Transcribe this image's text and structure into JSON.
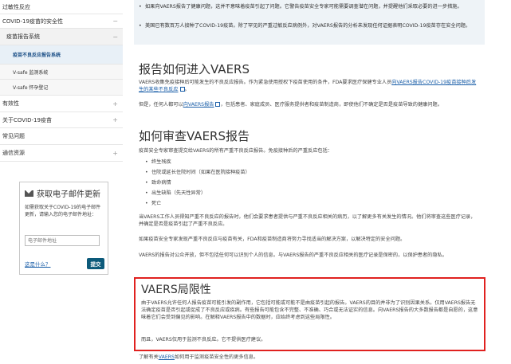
{
  "sidebar": {
    "items": [
      {
        "label": "过敏性反应",
        "toggle": ""
      },
      {
        "label": "COVID-19疫苗的安全性",
        "toggle": "−"
      },
      {
        "label": "疫苗报告系统",
        "toggle": "−"
      },
      {
        "label": "疫苗不良反应报告系统",
        "toggle": ""
      },
      {
        "label": "V-safe 监测系统",
        "toggle": ""
      },
      {
        "label": "V-safe 怀孕登记",
        "toggle": ""
      },
      {
        "label": "有效性",
        "toggle": "+"
      },
      {
        "label": "关于COVID-19疫苗",
        "toggle": "+"
      },
      {
        "label": "常见问题",
        "toggle": ""
      },
      {
        "label": "通信资源",
        "toggle": "+"
      }
    ],
    "email": {
      "title": "获取电子邮件更新",
      "body": "如需获取关于COVID-19的电子邮件更新，请输入您的电子邮件地址：",
      "placeholder": "电子邮件地址",
      "what_link": "这是什么？",
      "submit": "提交"
    }
  },
  "main": {
    "intro_bullets": [
      "如果向VAERS报告了健康问题，这并不意味着疫苗引起了问题。它警告疫苗安全专家可能需要调查潜在问题，并提醒他们采取必要的进一步措施。",
      "美国已有数百万人接种了COVID-19疫苗。除了罕见的严重过敏反应病例外，对VAERS报告的分析未发现任何证据表明COVID-19疫苗存在安全问题。"
    ],
    "section1": {
      "heading": "报告如何进入VAERS",
      "p1_before": "VAERS收集免疫接种后可能发生的不良反应报告。作为紧急使用授权下疫苗使用的条件，FDA要求医疗保健专业人员",
      "p1_link": "向VAERS报告COVID-19疫苗接种后发生的某些不良反应",
      "p1_after": "。",
      "p2_before": "但是，任何人都可以",
      "p2_link": "向VAERS报告",
      "p2_after": "，包括患者、家庭成员、医疗服务提供者和疫苗制造商，即使他们不确定是否是疫苗导致的健康问题。"
    },
    "section2": {
      "heading": "如何审查VAERS报告",
      "p1": "疫苗安全专家审查提交给VAERS的所有严重不良反应报告。免疫接种后的严重反应包括：",
      "bullets": [
        "终生残疾",
        "住院或延长住院时间（如果在医院接种疫苗）",
        "致命病情",
        "出生缺陷（先天性异常）",
        "死亡"
      ],
      "p2": "当VAERS工作人员得知严重不良反应的报告时，他们会要求患者提供与严重不良反应相关的病历，以了解更多有关发生的情况。他们将审查这些医疗记录，并确定是否是疫苗引起了严重不良反应。",
      "p3": "如果疫苗安全专家发现严重不良反应与疫苗有关，FDA和疫苗制造商将努力寻找适当的解决方案，以解决特定的安全问题。",
      "p4": "VAERS的报告对公众开放，但不包括任何可以识别个人的信息。与VAERS报告的严重不良反应相关的医疗记录是保密的，以保护患者的隐私。"
    },
    "section3": {
      "heading": "VAERS局限性",
      "p1": "由于VAERS允许任何人报告疫苗可能引发的副作用，它包括可能或可能不是由疫苗引起的报告。VAERS的目的并非为了识别因果关系。仅用VAERS报告无法确定疫苗是否引起或促成了不良反应或疾病。有些报告可能包含不完整、不准确、巧合或无法证实的信息。向VAERS报告的大多数报告都是自愿的，这意味着它们会受到偏见的影响。在解释VAERS报告中的数据时，应始终考虑到这些局限性。",
      "p2": "而且，VAERS仅用于监测不良反应。它不提供医疗建议。"
    },
    "footer": {
      "before": "了解有关",
      "link": "VAERS",
      "after": "如何用于监测疫苗安全性的更多信息。"
    }
  }
}
